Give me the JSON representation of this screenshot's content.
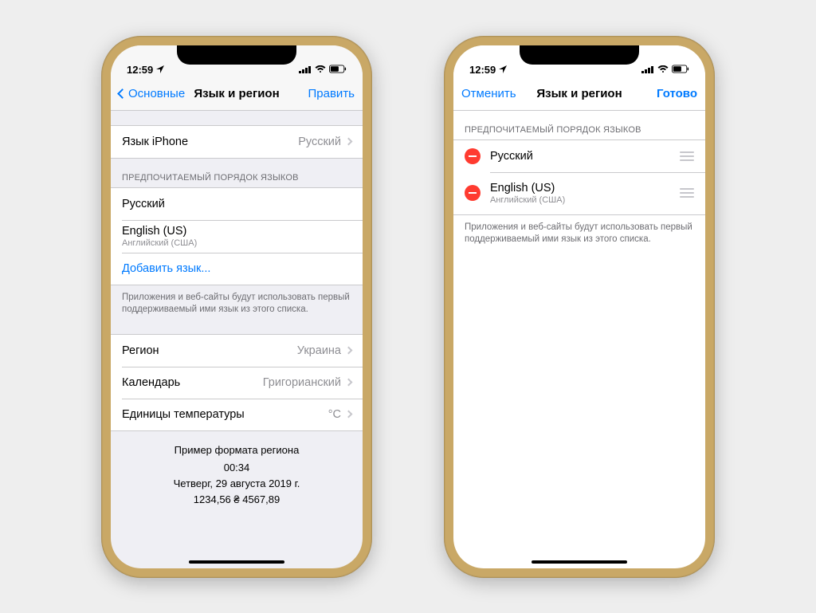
{
  "status": {
    "time": "12:59"
  },
  "left": {
    "nav": {
      "back": "Основные",
      "title": "Язык и регион",
      "edit": "Править"
    },
    "iphone_lang": {
      "label": "Язык iPhone",
      "value": "Русский"
    },
    "lang_header": "ПРЕДПОЧИТАЕМЫЙ ПОРЯДОК ЯЗЫКОВ",
    "langs": [
      {
        "title": "Русский",
        "subtitle": ""
      },
      {
        "title": "English (US)",
        "subtitle": "Английский (США)"
      }
    ],
    "add_lang": "Добавить язык...",
    "lang_footer": "Приложения и веб-сайты будут использовать первый поддерживаемый ими язык из этого списка.",
    "region": {
      "label": "Регион",
      "value": "Украина"
    },
    "calendar": {
      "label": "Календарь",
      "value": "Григорианский"
    },
    "temp": {
      "label": "Единицы температуры",
      "value": "°C"
    },
    "example_title": "Пример формата региона",
    "example_time": "00:34",
    "example_date": "Четверг, 29 августа 2019 г.",
    "example_numbers": "1234,56 ₴      4567,89"
  },
  "right": {
    "nav": {
      "cancel": "Отменить",
      "title": "Язык и регион",
      "done": "Готово"
    },
    "lang_header": "ПРЕДПОЧИТАЕМЫЙ ПОРЯДОК ЯЗЫКОВ",
    "langs": [
      {
        "title": "Русский",
        "subtitle": ""
      },
      {
        "title": "English (US)",
        "subtitle": "Английский (США)"
      }
    ],
    "lang_footer": "Приложения и веб-сайты будут использовать первый поддерживаемый ими язык из этого списка."
  }
}
